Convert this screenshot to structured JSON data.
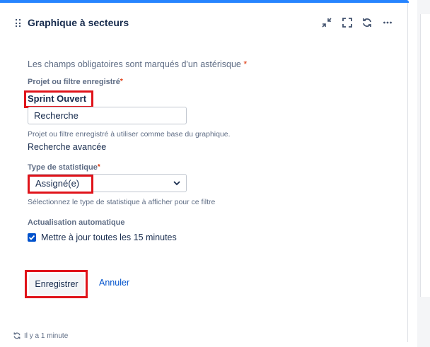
{
  "gadget": {
    "title": "Graphique à secteurs",
    "icons": [
      "minimize-icon",
      "fullscreen-icon",
      "refresh-icon",
      "more-icon"
    ]
  },
  "form": {
    "required_note": "Les champs obligatoires sont marqués d'un astérisque",
    "required_marker": "*",
    "project_filter": {
      "label": "Projet ou filtre enregistré",
      "selected": "Sprint Ouvert",
      "search_value": "Recherche",
      "help": "Projet ou filtre enregistré à utiliser comme base du graphique.",
      "advanced_search_link": "Recherche avancée"
    },
    "statistic_type": {
      "label": "Type de statistique",
      "selected": "Assigné(e)",
      "help": "Sélectionnez le type de statistique à afficher pour ce filtre"
    },
    "auto_refresh": {
      "label": "Actualisation automatique",
      "checkbox_label": "Mettre à jour toutes les 15 minutes",
      "checked": true
    },
    "buttons": {
      "save": "Enregistrer",
      "cancel": "Annuler"
    }
  },
  "footer": {
    "updated_text": "Il y a 1 minute"
  },
  "colors": {
    "accent": "#0052cc",
    "top_bar": "#2684ff",
    "highlight": "#e0131a",
    "required": "#de350b"
  }
}
